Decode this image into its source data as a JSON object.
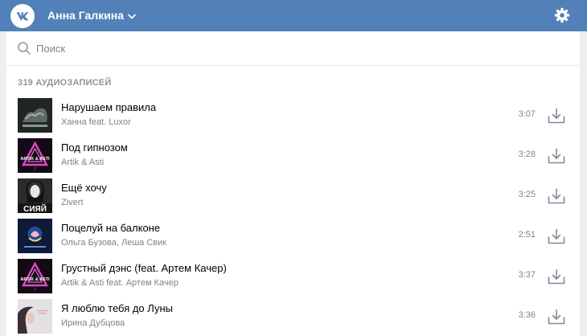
{
  "header": {
    "user_name": "Анна Галкина",
    "icons": [
      "vk-logo-icon",
      "chevron-down-icon",
      "gear-icon"
    ],
    "brand_color": "#5181b8"
  },
  "search": {
    "placeholder": "Поиск",
    "value": ""
  },
  "audio": {
    "count_label": "319 аудиозаписей",
    "tracks": [
      {
        "title": "Нарушаем правила",
        "artist": "Ханна feat. Luxor",
        "duration": "3:07",
        "cover": "dark-hands-cover"
      },
      {
        "title": "Под гипнозом",
        "artist": "Artik & Asti",
        "duration": "3:28",
        "cover": "neon-triangle-cover",
        "cover_caption": "ARTIK & ASTI"
      },
      {
        "title": "Ещё хочу",
        "artist": "Zivert",
        "duration": "3:25",
        "cover": "portrait-cover",
        "cover_caption": "СИЯЙ"
      },
      {
        "title": "Поцелуй на балконе",
        "artist": "Ольга Бузова, Леша Свик",
        "duration": "2:51",
        "cover": "balcony-night-cover"
      },
      {
        "title": "Грустный дэнс (feat. Артем Качер)",
        "artist": "Artik & Asti feat. Артем Качер",
        "duration": "3:37",
        "cover": "neon-triangle-cover",
        "cover_caption": "ARTIK & ASTI"
      },
      {
        "title": "Я люблю тебя до Луны",
        "artist": "Ирина Дубцова",
        "duration": "3:36",
        "cover": "light-portrait-cover"
      }
    ]
  }
}
